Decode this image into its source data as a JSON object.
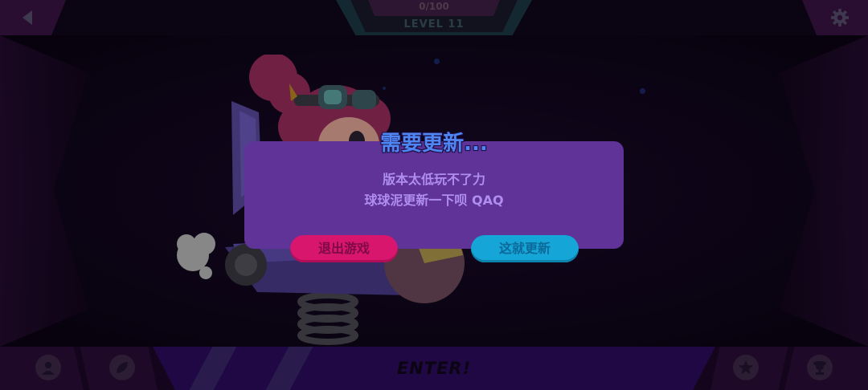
{
  "top_bar": {
    "progress": "0/100",
    "level": "LEVEL 11",
    "back_icon": "back-arrow-icon",
    "settings_icon": "gear-icon"
  },
  "bottom_bar": {
    "enter_label": "ENTER!",
    "left_icons": [
      "profile-icon",
      "leaf-icon"
    ],
    "right_icons": [
      "star-icon",
      "trophy-icon"
    ]
  },
  "dialog": {
    "title": "需要更新...",
    "message_line1": "版本太低玩不了力",
    "message_line2": "球球泥更新一下呗 QAQ",
    "exit_label": "退出游戏",
    "update_label": "这就更新"
  },
  "colors": {
    "dialog_bg": "#5f3398",
    "title": "#4f86f3",
    "exit_button": "#d9166e",
    "update_button": "#16a5d7"
  }
}
